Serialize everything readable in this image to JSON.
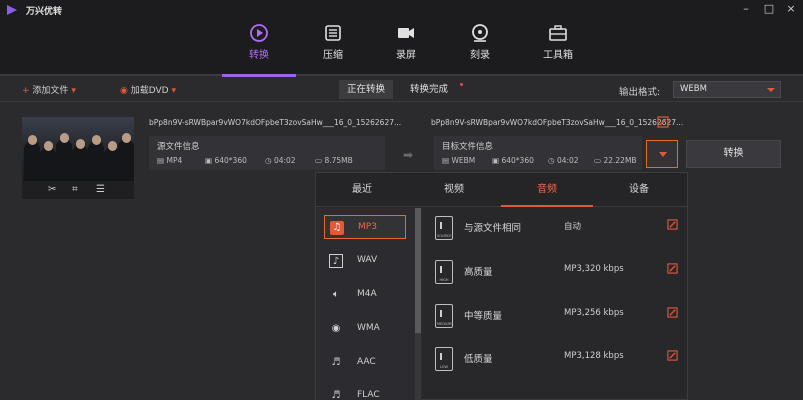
{
  "app": {
    "title": "万兴优转"
  },
  "window_controls": [
    "–",
    "□",
    "×"
  ],
  "nav": [
    {
      "label": "转换",
      "icon": "convert-icon",
      "active": true
    },
    {
      "label": "压缩",
      "icon": "compress-icon",
      "active": false
    },
    {
      "label": "录屏",
      "icon": "record-icon",
      "active": false
    },
    {
      "label": "刻录",
      "icon": "burn-icon",
      "active": false
    },
    {
      "label": "工具箱",
      "icon": "toolbox-icon",
      "active": false
    }
  ],
  "toolbar": {
    "add_file": "添加文件",
    "load_dvd": "加载DVD",
    "tab_converting": "正在转换",
    "tab_done": "转换完成",
    "output_format_label": "输出格式:",
    "output_format_value": "WEBM"
  },
  "file": {
    "source_name": "bPp8n9V-sRWBpar9vWO7kdOFpbeT3zovSaHw___16_0_15262627...",
    "target_name": "bPp8n9V-sRWBpar9vWO7kdOFpbeT3zovSaHw___16_0_15262627...",
    "source": {
      "title": "源文件信息",
      "format": "MP4",
      "resolution": "640*360",
      "duration": "04:02",
      "size": "8.75MB"
    },
    "target": {
      "title": "目标文件信息",
      "format": "WEBM",
      "resolution": "640*360",
      "duration": "04:02",
      "size": "22.22MB"
    },
    "convert_label": "转换"
  },
  "panel": {
    "tabs": [
      "最近",
      "视频",
      "音频",
      "设备"
    ],
    "active_tab": 2,
    "formats": [
      "MP3",
      "WAV",
      "M4A",
      "WMA",
      "AAC",
      "FLAC"
    ],
    "selected_format": 0,
    "qualities": [
      {
        "name": "与源文件相同",
        "value": "自动",
        "tag": "SOURCE"
      },
      {
        "name": "高质量",
        "value": "MP3,320 kbps",
        "tag": "HIGH"
      },
      {
        "name": "中等质量",
        "value": "MP3,256 kbps",
        "tag": "MEDIUM"
      },
      {
        "name": "低质量",
        "value": "MP3,128 kbps",
        "tag": "LOW"
      }
    ]
  },
  "colors": {
    "accent": "#a060f0",
    "orange": "#e86a2a",
    "bg": "#2b2b2e"
  }
}
